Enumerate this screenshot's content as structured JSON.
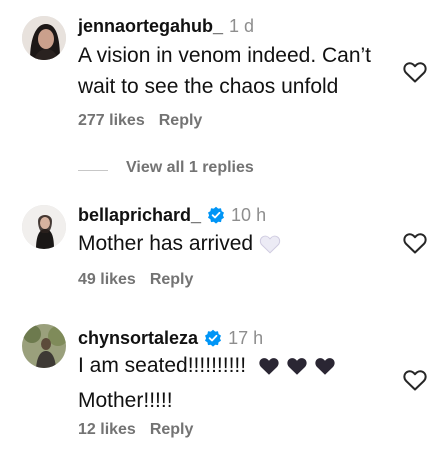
{
  "comments": [
    {
      "username": "jennaortegahub_",
      "time": "1 d",
      "verified": false,
      "text": "A vision in venom indeed. Can’t wait to see the chaos unfold",
      "likes": "277 likes",
      "reply_label": "Reply",
      "view_replies": "View all 1 replies"
    },
    {
      "username": "bellaprichard_",
      "time": "10 h",
      "verified": true,
      "text": "Mother has arrived",
      "emoji": "white-heart",
      "likes": "49 likes",
      "reply_label": "Reply"
    },
    {
      "username": "chynsortaleza",
      "time": "17 h",
      "verified": true,
      "text_line1": "I am seated!!!!!!!!!!",
      "emoji": "black-heart",
      "emoji_count": 3,
      "text_line2": "Mother!!!!!",
      "likes": "12 likes",
      "reply_label": "Reply"
    }
  ],
  "colors": {
    "text": "#111111",
    "muted": "#737373",
    "verified": "#0095f6"
  },
  "icons": {
    "like": "heart-outline-icon",
    "verified": "verified-badge-icon"
  }
}
